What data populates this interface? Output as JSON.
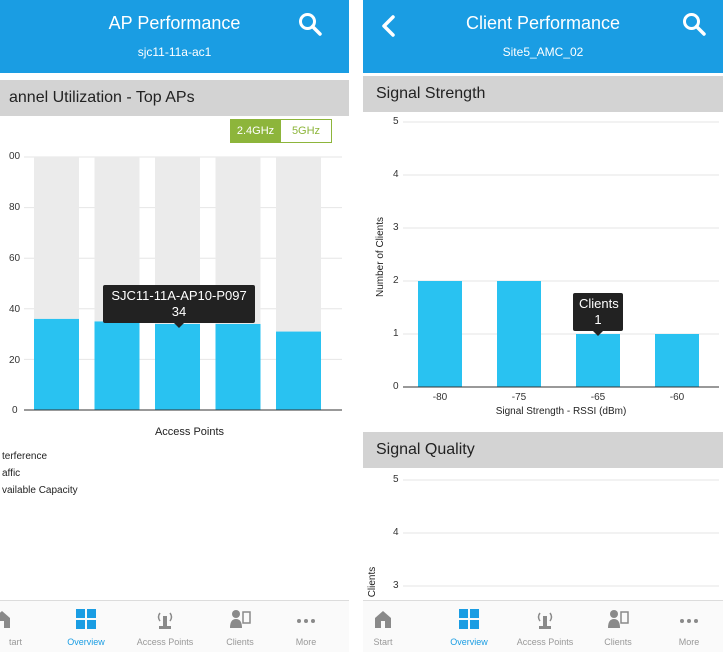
{
  "colors": {
    "header": "#1a9de3",
    "bar": "#29c2f1",
    "bar_bg": "#ebebeb",
    "section": "#d3d3d3",
    "band_active": "#8db53b"
  },
  "ap": {
    "title": "AP Performance",
    "subtitle": "sjc11-11a-ac1",
    "section": "annel Utilization - Top APs",
    "band": {
      "active": "2.4GHz",
      "inactive": "5GHz"
    },
    "tooltip": {
      "name": "SJC11-11A-AP10-P097",
      "value": "34"
    },
    "legend": [
      "terference",
      "affic",
      "vailable Capacity"
    ],
    "chart_data": {
      "type": "bar",
      "xlabel": "Access Points",
      "ylabel": "",
      "ylim": [
        0,
        100
      ],
      "yticks": [
        "00",
        "80",
        "60",
        "40",
        "20",
        "0"
      ],
      "series": [
        {
          "name": "affic",
          "values": [
            36,
            35,
            34,
            34,
            31
          ]
        },
        {
          "name": "vailable Capacity",
          "values": [
            64,
            65,
            66,
            66,
            69
          ]
        }
      ]
    }
  },
  "client": {
    "title": "Client Performance",
    "subtitle": "Site5_AMC_02",
    "strength_section": "Signal Strength",
    "quality_section": "Signal Quality",
    "tooltip": {
      "name": "Clients",
      "value": "1"
    },
    "chart_data": [
      {
        "type": "bar",
        "categories": [
          "-80",
          "-75",
          "-65",
          "-60"
        ],
        "values": [
          2,
          2,
          1,
          1
        ],
        "xlabel": "Signal Strength - RSSI (dBm)",
        "ylabel": "Number of Clients",
        "ylim": [
          0,
          5
        ],
        "yticks": [
          "5",
          "4",
          "3",
          "2",
          "1",
          "0"
        ]
      },
      {
        "type": "bar",
        "categories": [],
        "values": [],
        "xlabel": "",
        "ylabel": "Clients",
        "ylim": [
          0,
          5
        ],
        "yticks": [
          "5",
          "4",
          "3"
        ]
      }
    ]
  },
  "tabs": {
    "left": [
      "tart",
      "Overview",
      "Access Points",
      "Clients",
      "More"
    ],
    "right": [
      "Start",
      "Overview",
      "Access Points",
      "Clients",
      "More"
    ]
  }
}
